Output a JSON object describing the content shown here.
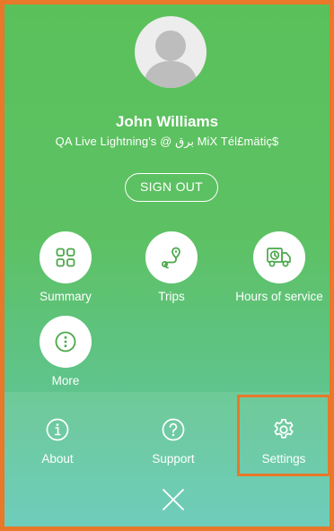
{
  "profile": {
    "name": "John Williams",
    "organization": "QA Live Lightning's @ برق MiX Tél£mätiç$"
  },
  "sign_out_label": "SIGN OUT",
  "menu": {
    "items": [
      {
        "label": "Summary",
        "icon": "grid-icon"
      },
      {
        "label": "Trips",
        "icon": "route-icon"
      },
      {
        "label": "Hours of service",
        "icon": "truck-clock-icon"
      },
      {
        "label": "More",
        "icon": "more-icon"
      }
    ]
  },
  "bottom": {
    "items": [
      {
        "label": "About",
        "icon": "info-icon"
      },
      {
        "label": "Support",
        "icon": "help-icon"
      },
      {
        "label": "Settings",
        "icon": "gear-icon"
      }
    ],
    "close_icon": "close-icon"
  },
  "colors": {
    "accent_green": "#4aa84a",
    "highlight_border": "#e8782a",
    "background_top": "#5ac15a",
    "background_bottom": "#5ec8b4"
  }
}
